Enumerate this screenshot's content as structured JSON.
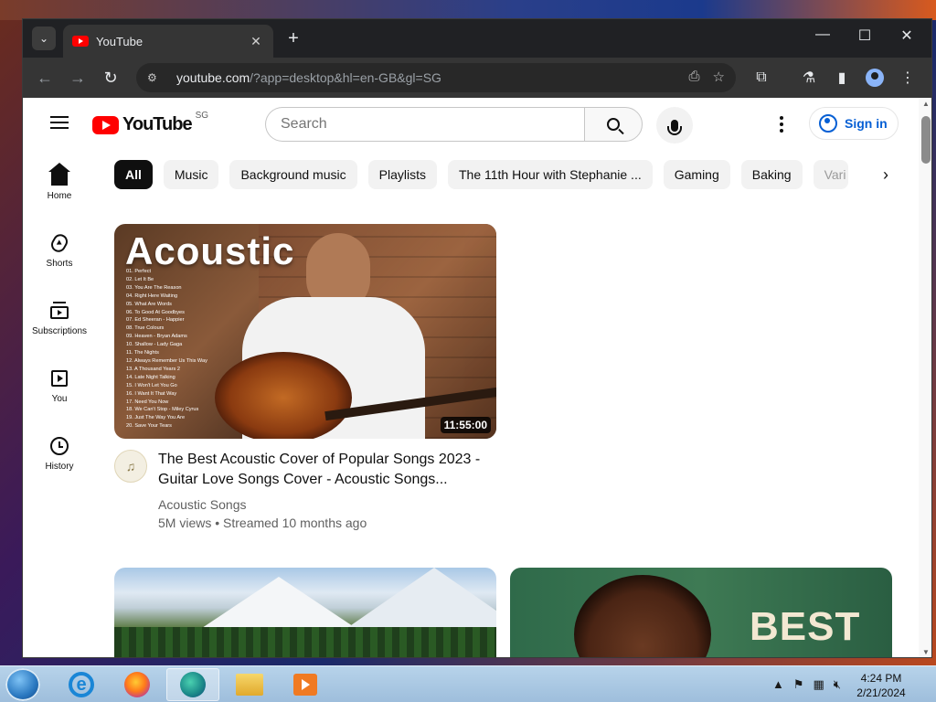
{
  "browser": {
    "tab_title": "YouTube",
    "tab_close": "✕",
    "new_tab": "+",
    "url_host": "youtube.com",
    "url_path": "/?app=desktop&hl=en-GB&gl=SG",
    "win_min": "—",
    "win_max": "☐",
    "win_close": "✕"
  },
  "header": {
    "logo_text": "YouTube",
    "country": "SG",
    "search_placeholder": "Search",
    "signin_label": "Sign in"
  },
  "chips": [
    "All",
    "Music",
    "Background music",
    "Playlists",
    "The 11th Hour with Stephanie ...",
    "Gaming",
    "Baking",
    "Vari"
  ],
  "sidebar": {
    "items": [
      {
        "label": "Home"
      },
      {
        "label": "Shorts"
      },
      {
        "label": "Subscriptions"
      },
      {
        "label": "You"
      },
      {
        "label": "History"
      }
    ]
  },
  "videos": [
    {
      "thumb_title": "Acoustic",
      "tracklist": "01. Perfect\n02. Let It Be\n03. You Are The Reason\n04. Right Here Waiting\n05. What Are Words\n06. To Good At Goodbyes\n07. Ed Sheeran - Happier\n08. True Colours\n09. Heaven - Bryan Adams\n10. Shallow - Lady Gaga\n11. The Nights\n12. Always Remember Us This Way\n13. A Thousand Years 2\n14. Late Night Talking\n15. I Won't Let You Go\n16. I Want It That Way\n17. Need You Now\n18. We Can't Stop - Miley Cyrus\n19. Just The Way You Are\n20. Save Your Tears",
      "duration": "11:55:00",
      "title": "The Best Acoustic Cover of Popular Songs 2023 - Guitar Love Songs Cover - Acoustic Songs...",
      "channel": "Acoustic Songs",
      "stats": "5M views • Streamed 10 months ago"
    }
  ],
  "thumb3_text": "BEST",
  "taskbar": {
    "time": "4:24 PM",
    "date": "2/21/2024"
  }
}
